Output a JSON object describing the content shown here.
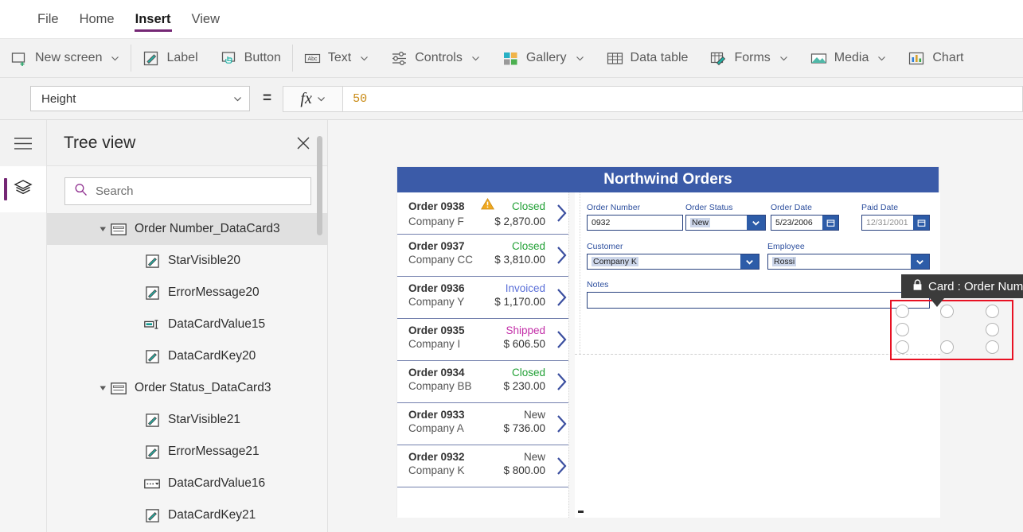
{
  "menu": {
    "tabs": [
      {
        "label": "File",
        "active": false
      },
      {
        "label": "Home",
        "active": false
      },
      {
        "label": "Insert",
        "active": true
      },
      {
        "label": "View",
        "active": false
      }
    ]
  },
  "ribbon": {
    "items": [
      {
        "label": "New screen",
        "icon": "new-screen-icon",
        "caret": true
      },
      {
        "label": "Label",
        "icon": "label-icon",
        "caret": false
      },
      {
        "label": "Button",
        "icon": "button-icon",
        "caret": false
      },
      {
        "label": "Text",
        "icon": "text-abc-icon",
        "caret": true
      },
      {
        "label": "Controls",
        "icon": "controls-sliders-icon",
        "caret": true
      },
      {
        "label": "Gallery",
        "icon": "gallery-grid-icon",
        "caret": true
      },
      {
        "label": "Data table",
        "icon": "data-table-icon",
        "caret": false
      },
      {
        "label": "Forms",
        "icon": "forms-icon",
        "caret": true
      },
      {
        "label": "Media",
        "icon": "media-image-icon",
        "caret": true
      },
      {
        "label": "Chart",
        "icon": "chart-bars-icon",
        "caret": false
      }
    ]
  },
  "formula_bar": {
    "property": "Height",
    "equals": "=",
    "fx_label": "fx",
    "value": "50",
    "value_color": "#c98a14"
  },
  "rail": {
    "hamburger": "hamburger-icon",
    "buttons": [
      {
        "icon": "layers-icon",
        "active": true
      }
    ],
    "accent": "#742774"
  },
  "tree_panel": {
    "title": "Tree view",
    "close_label": "✕",
    "search": {
      "placeholder": "Search",
      "value": ""
    },
    "items": [
      {
        "label": "Order Number_DataCard3",
        "icon": "datacard-icon",
        "depth": 0,
        "twisty": true,
        "selected": true
      },
      {
        "label": "StarVisible20",
        "icon": "label-pencil-icon",
        "depth": 1,
        "twisty": false,
        "selected": false
      },
      {
        "label": "ErrorMessage20",
        "icon": "label-pencil-icon",
        "depth": 1,
        "twisty": false,
        "selected": false
      },
      {
        "label": "DataCardValue15",
        "icon": "textinput-icon",
        "depth": 1,
        "twisty": false,
        "selected": false
      },
      {
        "label": "DataCardKey20",
        "icon": "label-pencil-icon",
        "depth": 1,
        "twisty": false,
        "selected": false
      },
      {
        "label": "Order Status_DataCard3",
        "icon": "datacard-icon",
        "depth": 0,
        "twisty": true,
        "selected": false
      },
      {
        "label": "StarVisible21",
        "icon": "label-pencil-icon",
        "depth": 1,
        "twisty": false,
        "selected": false
      },
      {
        "label": "ErrorMessage21",
        "icon": "label-pencil-icon",
        "depth": 1,
        "twisty": false,
        "selected": false
      },
      {
        "label": "DataCardValue16",
        "icon": "dropdown-icon",
        "depth": 1,
        "twisty": false,
        "selected": false
      },
      {
        "label": "DataCardKey21",
        "icon": "label-pencil-icon",
        "depth": 1,
        "twisty": false,
        "selected": false
      }
    ]
  },
  "tooltip": {
    "lock_icon": "lock-icon",
    "text": "Card : Order Number"
  },
  "app_preview": {
    "header_title": "Northwind Orders",
    "header_color": "#3b5ba8",
    "status_colors": {
      "Closed": "#21a035",
      "Invoiced": "#5a6fd8",
      "Shipped": "#c32fa8",
      "New": "#4a4a4a"
    },
    "gallery": [
      {
        "order": "Order 0938",
        "company": "Company F",
        "status": "Closed",
        "amount": "$ 2,870.00",
        "warning": true
      },
      {
        "order": "Order 0937",
        "company": "Company CC",
        "status": "Closed",
        "amount": "$ 3,810.00",
        "warning": false
      },
      {
        "order": "Order 0936",
        "company": "Company Y",
        "status": "Invoiced",
        "amount": "$ 1,170.00",
        "warning": false
      },
      {
        "order": "Order 0935",
        "company": "Company I",
        "status": "Shipped",
        "amount": "$ 606.50",
        "warning": false
      },
      {
        "order": "Order 0934",
        "company": "Company BB",
        "status": "Closed",
        "amount": "$ 230.00",
        "warning": false
      },
      {
        "order": "Order 0933",
        "company": "Company A",
        "status": "New",
        "amount": "$ 736.00",
        "warning": false
      },
      {
        "order": "Order 0932",
        "company": "Company K",
        "status": "New",
        "amount": "$ 800.00",
        "warning": false
      }
    ],
    "form": {
      "order_number": {
        "label": "Order Number",
        "value": "0932"
      },
      "order_status": {
        "label": "Order Status",
        "value": "New"
      },
      "order_date": {
        "label": "Order Date",
        "value": "5/23/2006"
      },
      "paid_date": {
        "label": "Paid Date",
        "value": "12/31/2001"
      },
      "customer": {
        "label": "Customer",
        "value": "Company K"
      },
      "employee": {
        "label": "Employee",
        "value": "Rossi"
      },
      "notes": {
        "label": "Notes",
        "value": ""
      }
    }
  },
  "selection": {
    "color": "#e81123",
    "handle_count": 8
  }
}
